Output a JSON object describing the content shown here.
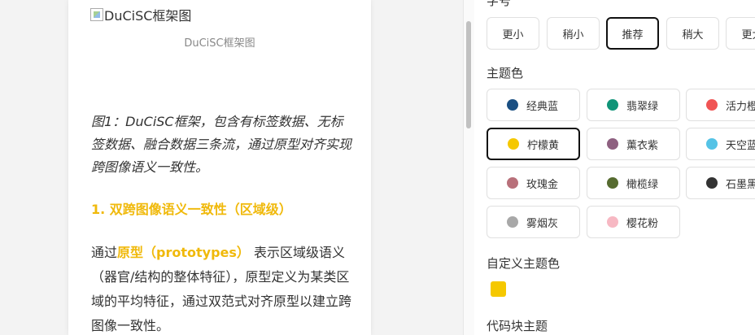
{
  "article": {
    "image_alt": "DuCiSC框架图",
    "image_caption": "DuCiSC框架图",
    "figure_text": "图1：DuCiSC框架，包含有标签数据、无标签数据、融合数据三条流，通过原型对齐实现跨图像语义一致性。",
    "section_heading": "1. 双跨图像语义一致性（区域级）",
    "para_prefix": "通过",
    "para_highlight": "原型（prototypes）",
    "para_suffix": " 表示区域级语义（器官/结构的整体特征），原型定义为某类区域的平均特征，通过双范式对齐原型以建立跨图像一致性。",
    "accent_color": "#f0b90b"
  },
  "settings": {
    "font_size_label": "字号",
    "font_sizes": [
      {
        "label": "更小",
        "active": false
      },
      {
        "label": "稍小",
        "active": false
      },
      {
        "label": "推荐",
        "active": true
      },
      {
        "label": "稍大",
        "active": false
      },
      {
        "label": "更大",
        "active": false
      }
    ],
    "theme_color_label": "主题色",
    "theme_colors": [
      {
        "label": "经典蓝",
        "color": "#1a4f82",
        "active": false
      },
      {
        "label": "翡翠绿",
        "color": "#109478",
        "active": false
      },
      {
        "label": "活力橙",
        "color": "#f05454",
        "active": false
      },
      {
        "label": "柠檬黄",
        "color": "#f5c800",
        "active": true
      },
      {
        "label": "薰衣紫",
        "color": "#8e6080",
        "active": false
      },
      {
        "label": "天空蓝",
        "color": "#55c3e6",
        "active": false
      },
      {
        "label": "玫瑰金",
        "color": "#b8707a",
        "active": false
      },
      {
        "label": "橄榄绿",
        "color": "#566b30",
        "active": false
      },
      {
        "label": "石墨黑",
        "color": "#333333",
        "active": false
      },
      {
        "label": "雾烟灰",
        "color": "#a8a8a8",
        "active": false
      },
      {
        "label": "樱花粉",
        "color": "#f7b8c3",
        "active": false
      }
    ],
    "custom_color_label": "自定义主题色",
    "custom_color": "#f5c800",
    "code_theme_label": "代码块主题"
  }
}
